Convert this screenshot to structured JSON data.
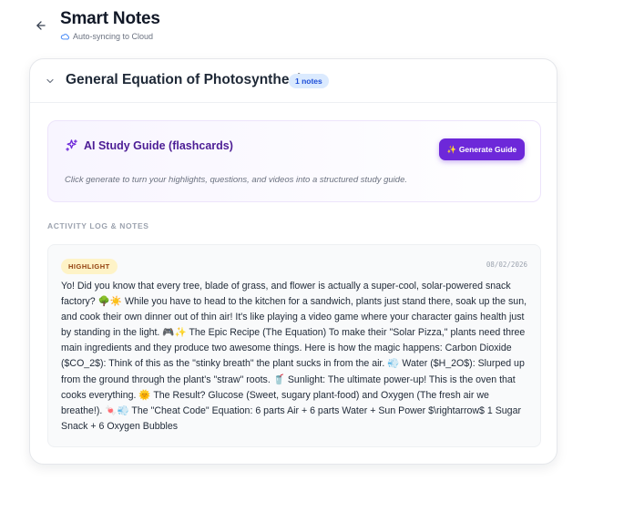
{
  "header": {
    "title": "Smart Notes",
    "sync_status": "Auto-syncing to Cloud",
    "back_icon": "arrow-left-icon",
    "sync_icon": "cloud-icon"
  },
  "section": {
    "title": "General Equation of Photosynthesis",
    "notes_count": "1 notes",
    "collapse_icon": "chevron-down-icon"
  },
  "study_guide": {
    "title": "AI Study Guide (flashcards)",
    "button_label": "✨ Generate Guide",
    "description": "Click generate to turn your highlights, questions, and videos into a structured study guide.",
    "icon": "sparkles-icon"
  },
  "activity": {
    "label": "ACTIVITY LOG & NOTES",
    "notes": [
      {
        "tag": "HIGHLIGHT",
        "date": "08/02/2026",
        "text": "Yo! Did you know that every tree, blade of grass, and flower is actually a super-cool, solar-powered snack factory? 🌳☀️ While you have to head to the kitchen for a sandwich, plants just stand there, soak up the sun, and cook their own dinner out of thin air! It's like playing a video game where your character gains health just by standing in the light. 🎮✨ The Epic Recipe (The Equation) To make their \"Solar Pizza,\" plants need three main ingredients and they produce two awesome things. Here is how the magic happens: Carbon Dioxide ($CO_2$): Think of this as the \"stinky breath\" the plant sucks in from the air. 💨 Water ($H_2O$): Slurped up from the ground through the plant's \"straw\" roots. 🥤 Sunlight: The ultimate power-up! This is the oven that cooks everything. 🌞 The Result? Glucose (Sweet, sugary plant-food) and Oxygen (The fresh air we breathe!). 🍬💨 The \"Cheat Code\" Equation: 6 parts Air + 6 parts Water + Sun Power $\\rightarrow$ 1 Sugar Snack + 6 Oxygen Bubbles"
      }
    ]
  },
  "colors": {
    "accent": "#6d28d9",
    "study_title": "#4c1d95",
    "badge_bg": "#dbeafe",
    "highlight_bg": "#fef3c7"
  }
}
